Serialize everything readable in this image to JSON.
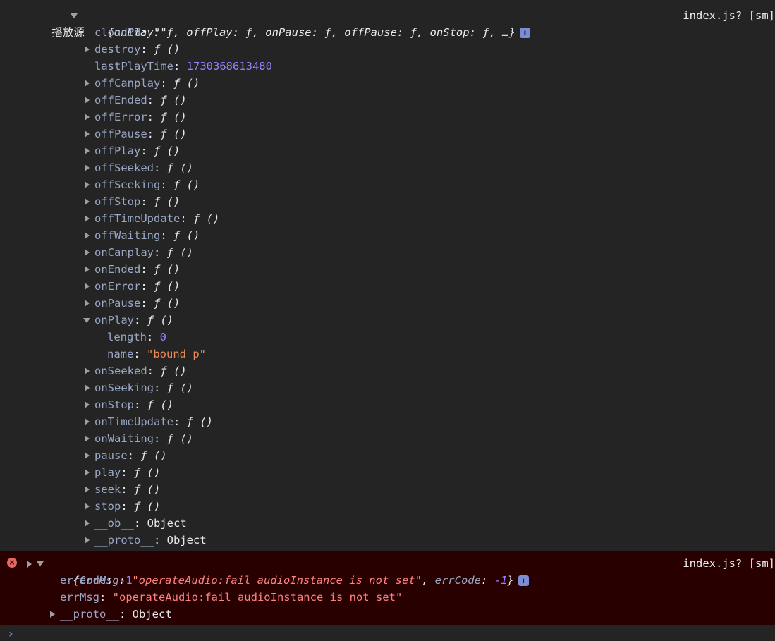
{
  "entry1": {
    "label": "播放源",
    "summary": "{onPlay: ƒ, offPlay: ƒ, onPause: ƒ, offPause: ƒ, onStop: ƒ, …}",
    "source": "index.js? [sm]",
    "info_badge": "i",
    "props": [
      {
        "key": "cloudId",
        "sep": ": ",
        "value": "\"\"",
        "type": "str-plain",
        "expandable": false
      },
      {
        "key": "destroy",
        "sep": ": ",
        "value": "ƒ ()",
        "type": "fn",
        "expandable": true
      },
      {
        "key": "lastPlayTime",
        "sep": ": ",
        "value": "1730368613480",
        "type": "num",
        "expandable": false
      },
      {
        "key": "offCanplay",
        "sep": ": ",
        "value": "ƒ ()",
        "type": "fn",
        "expandable": true
      },
      {
        "key": "offEnded",
        "sep": ": ",
        "value": "ƒ ()",
        "type": "fn",
        "expandable": true
      },
      {
        "key": "offError",
        "sep": ": ",
        "value": "ƒ ()",
        "type": "fn",
        "expandable": true
      },
      {
        "key": "offPause",
        "sep": ": ",
        "value": "ƒ ()",
        "type": "fn",
        "expandable": true
      },
      {
        "key": "offPlay",
        "sep": ": ",
        "value": "ƒ ()",
        "type": "fn",
        "expandable": true
      },
      {
        "key": "offSeeked",
        "sep": ": ",
        "value": "ƒ ()",
        "type": "fn",
        "expandable": true
      },
      {
        "key": "offSeeking",
        "sep": ": ",
        "value": "ƒ ()",
        "type": "fn",
        "expandable": true
      },
      {
        "key": "offStop",
        "sep": ": ",
        "value": "ƒ ()",
        "type": "fn",
        "expandable": true
      },
      {
        "key": "offTimeUpdate",
        "sep": ": ",
        "value": "ƒ ()",
        "type": "fn",
        "expandable": true
      },
      {
        "key": "offWaiting",
        "sep": ": ",
        "value": "ƒ ()",
        "type": "fn",
        "expandable": true
      },
      {
        "key": "onCanplay",
        "sep": ": ",
        "value": "ƒ ()",
        "type": "fn",
        "expandable": true
      },
      {
        "key": "onEnded",
        "sep": ": ",
        "value": "ƒ ()",
        "type": "fn",
        "expandable": true
      },
      {
        "key": "onError",
        "sep": ": ",
        "value": "ƒ ()",
        "type": "fn",
        "expandable": true
      },
      {
        "key": "onPause",
        "sep": ": ",
        "value": "ƒ ()",
        "type": "fn",
        "expandable": true
      },
      {
        "key": "onPlay",
        "sep": ": ",
        "value": "ƒ ()",
        "type": "fn",
        "expandable": true,
        "expanded": true
      },
      {
        "key": "length",
        "sep": ": ",
        "value": "0",
        "type": "num",
        "expandable": false,
        "child": true
      },
      {
        "key": "name",
        "sep": ": ",
        "value": "\"bound p\"",
        "type": "str",
        "expandable": false,
        "child": true
      },
      {
        "key": "onSeeked",
        "sep": ": ",
        "value": "ƒ ()",
        "type": "fn",
        "expandable": true
      },
      {
        "key": "onSeeking",
        "sep": ": ",
        "value": "ƒ ()",
        "type": "fn",
        "expandable": true
      },
      {
        "key": "onStop",
        "sep": ": ",
        "value": "ƒ ()",
        "type": "fn",
        "expandable": true
      },
      {
        "key": "onTimeUpdate",
        "sep": ": ",
        "value": "ƒ ()",
        "type": "fn",
        "expandable": true
      },
      {
        "key": "onWaiting",
        "sep": ": ",
        "value": "ƒ ()",
        "type": "fn",
        "expandable": true
      },
      {
        "key": "pause",
        "sep": ": ",
        "value": "ƒ ()",
        "type": "fn",
        "expandable": true
      },
      {
        "key": "play",
        "sep": ": ",
        "value": "ƒ ()",
        "type": "fn",
        "expandable": true
      },
      {
        "key": "seek",
        "sep": ": ",
        "value": "ƒ ()",
        "type": "fn",
        "expandable": true
      },
      {
        "key": "stop",
        "sep": ": ",
        "value": "ƒ ()",
        "type": "fn",
        "expandable": true
      },
      {
        "key": "__ob__",
        "sep": ": ",
        "value": "Object",
        "type": "plain",
        "expandable": true
      },
      {
        "key": "__proto__",
        "sep": ": ",
        "value": "Object",
        "type": "plain",
        "expandable": true
      }
    ]
  },
  "entry2": {
    "summary_open": "{",
    "summary_key1": "errMsg",
    "summary_val1": "\"operateAudio:fail audioInstance is not set\"",
    "summary_sep": ", ",
    "summary_key2": "errCode",
    "summary_val2": "-1",
    "summary_close": "}",
    "source": "index.js? [sm]",
    "info_badge": "i",
    "error_icon": "×",
    "props": [
      {
        "key": "errCode",
        "value": "-1",
        "type": "num"
      },
      {
        "key": "errMsg",
        "value": "\"operateAudio:fail audioInstance is not set\"",
        "type": "str-err"
      },
      {
        "key": "__proto__",
        "value": "Object",
        "type": "plain",
        "expandable": true
      }
    ]
  },
  "prompt": {
    "chevron": "›"
  },
  "colors": {
    "background": "#242424",
    "error_background": "#290000",
    "key": "#9aa8c6",
    "number": "#9980ff",
    "string": "#f28b54",
    "error_string": "#ff8080",
    "prompt": "#4d90fe"
  }
}
